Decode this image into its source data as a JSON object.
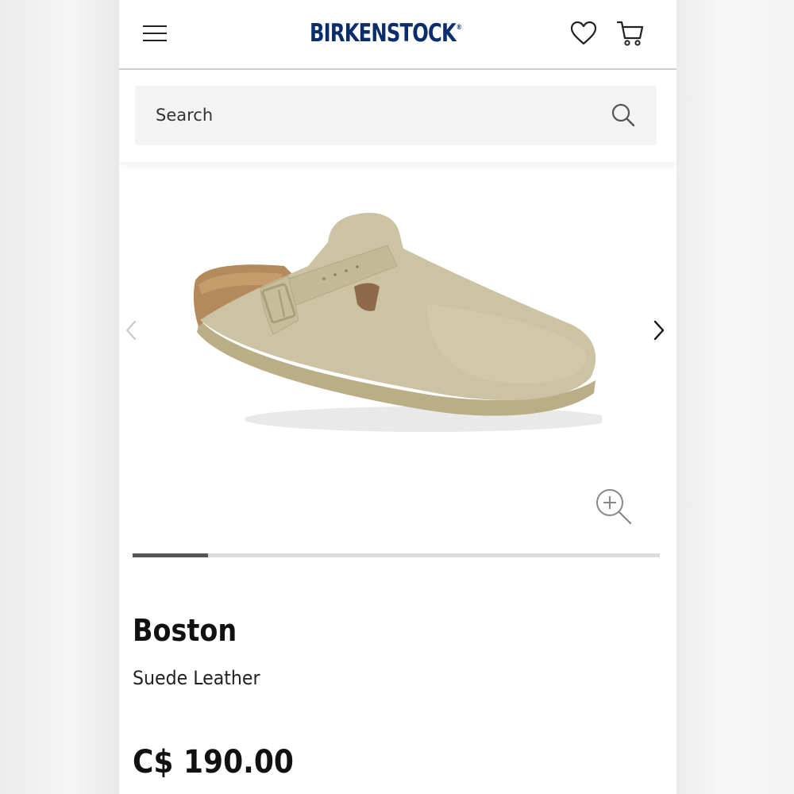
{
  "header": {
    "logo_text": "BIRKENSTOCK",
    "logo_mark": "®",
    "menu_icon": "hamburger-menu-icon",
    "wishlist_icon": "heart-icon",
    "cart_icon": "cart-icon"
  },
  "search": {
    "placeholder": "Search",
    "value": "",
    "icon": "search-icon"
  },
  "gallery": {
    "prev_icon": "chevron-left-icon",
    "next_icon": "chevron-right-icon",
    "zoom_icon": "zoom-in-icon",
    "image_alt": "Boston clog in taupe suede",
    "progress_fraction": 0.143
  },
  "product": {
    "name": "Boston",
    "material": "Suede Leather",
    "price": "C$ 190.00"
  },
  "colors": {
    "logo": "#0a2d6e",
    "suede": "#cbc3a3",
    "cork": "#b48a5c",
    "progress_active": "#555555",
    "progress_track": "#dcdcdc"
  }
}
